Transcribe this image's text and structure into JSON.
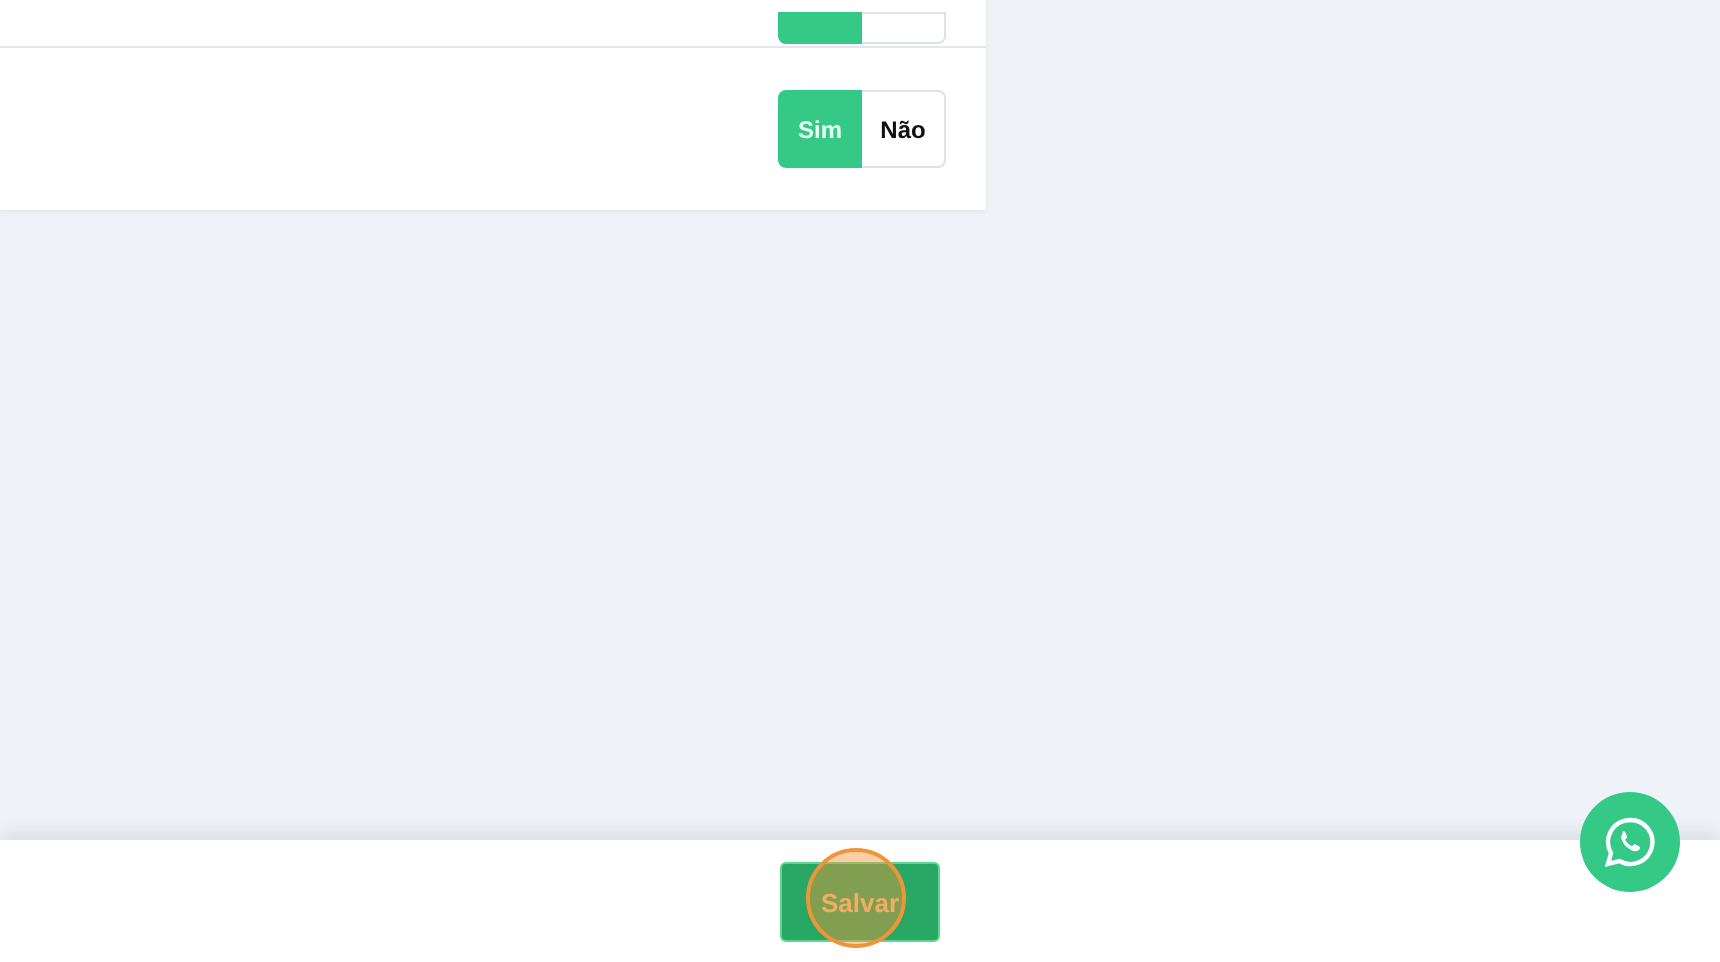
{
  "settings_card": {
    "rows": [
      {
        "options": [
          {
            "selected": true
          },
          {
            "selected": false
          }
        ]
      },
      {
        "options": [
          {
            "label": "Sim",
            "selected": true
          },
          {
            "label": "Não",
            "selected": false
          }
        ]
      }
    ]
  },
  "footer": {
    "save_button": "Salvar",
    "click_highlight": true
  },
  "whatsapp_button": true
}
